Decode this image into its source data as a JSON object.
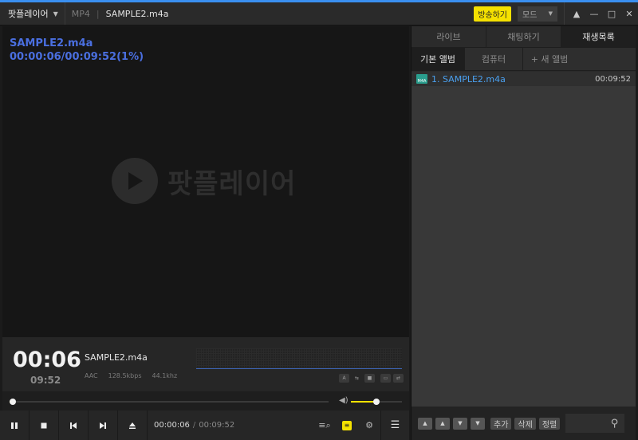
{
  "titlebar": {
    "app_menu": "팟플레이어",
    "format": "MP4",
    "file_title": "SAMPLE2.m4a",
    "broadcast_label": "방송하기",
    "mode_label": "모드"
  },
  "video": {
    "osd_filename": "SAMPLE2.m4a",
    "osd_time": "00:00:06/00:09:52(1%)",
    "watermark_text": "팟플레이어"
  },
  "info": {
    "current_time": "00:06",
    "total_time": "09:52",
    "filename": "SAMPLE2.m4a",
    "codec": "AAC",
    "bitrate": "128.5kbps",
    "samplerate": "44.1khz"
  },
  "seek": {
    "progress_percent": 1,
    "volume_percent": 50
  },
  "controls": {
    "time_current": "00:00:06",
    "time_separator": "/",
    "time_total": "00:09:52"
  },
  "right_panel": {
    "tabs": [
      "라이브",
      "채팅하기",
      "재생목록"
    ],
    "active_tab": 2,
    "subtabs": [
      "기본 앨범",
      "컴퓨터",
      "+ 새 앨범"
    ],
    "playlist": [
      {
        "label": "1. SAMPLE2.m4a",
        "duration": "00:09:52",
        "icon_text": "M4A"
      }
    ],
    "bottom_buttons": {
      "add": "추가",
      "delete": "삭제",
      "sort": "정렬"
    }
  },
  "colors": {
    "accent_yellow": "#f5e100",
    "osd_blue": "#4a6fe0",
    "playlist_blue": "#4aa0ef",
    "top_accent": "#3a8ff0"
  },
  "icons": [
    "chevron-down-icon",
    "pin-icon",
    "minimize-icon",
    "maximize-icon",
    "close-icon",
    "play-icon",
    "pause-icon",
    "stop-icon",
    "prev-icon",
    "next-icon",
    "eject-icon",
    "playlist-search-icon",
    "settings-icon",
    "menu-icon",
    "search-icon",
    "volume-icon"
  ]
}
